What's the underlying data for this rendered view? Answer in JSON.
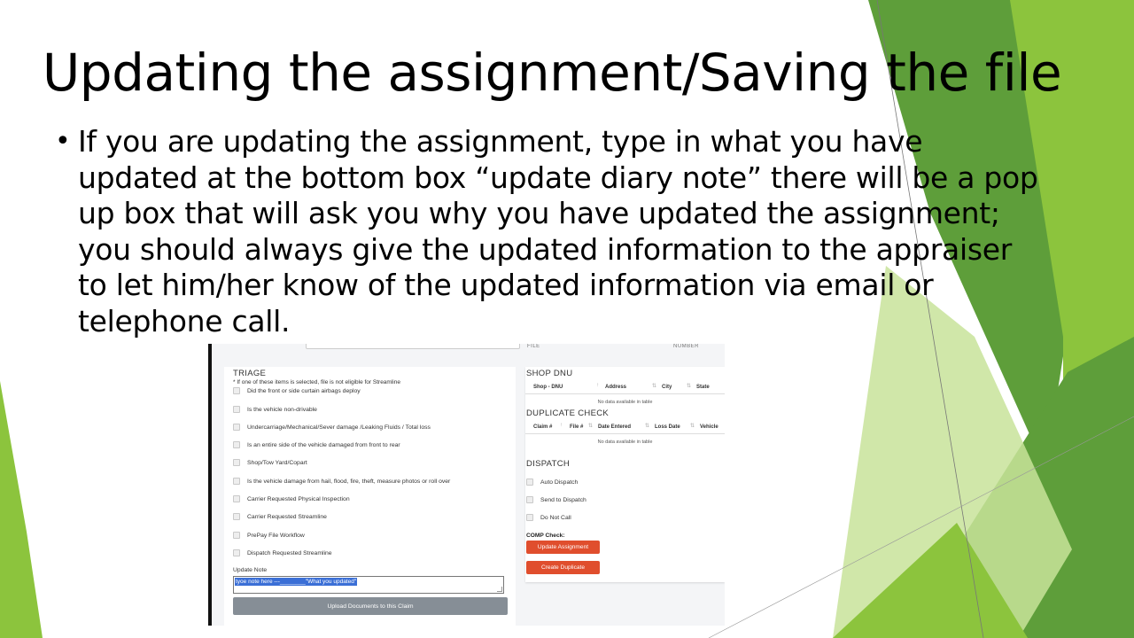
{
  "slide": {
    "title": "Updating the assignment/Saving the file",
    "bullet_symbol": "•",
    "bullet_text": "If you are updating the assignment, type in what you have updated at the bottom box “update diary note” there will be a pop up box that will ask you why you have updated the assignment; you should always give the updated information to the appraiser to let him/her know of the updated information via email or telephone call."
  },
  "colors": {
    "green_dark": "#3f7d2b",
    "green_mid": "#5e9e3a",
    "green_light": "#8cc43d",
    "green_pale": "#c8e39a",
    "button_red": "#e04e2d",
    "button_gray": "#868e96"
  },
  "screenshot": {
    "header_file": "FILE",
    "header_number": "NUMBER",
    "triage": {
      "title": "TRIAGE",
      "note": "* If one of these items is selected, file is not eligible for Streamline",
      "items": [
        "Did the front or side curtain airbags deploy",
        "Is the vehicle non-drivable",
        "Undercarriage/Mechanical/Sever damage /Leaking Fluids / Total loss",
        "Is an entire side of the vehicle damaged from front to rear",
        "Shop/Tow Yard/Copart",
        "Is the vehicle damage from hail, flood, fire, theft, measure photos or roll over",
        "Carrier Requested Physical Inspection",
        "Carrier Requested Streamline",
        "PrePay File Workflow",
        "Dispatch Requested Streamline"
      ]
    },
    "update_note": {
      "label": "Update Note",
      "value": "tyoe note here ---________\"What you updated\""
    },
    "upload_button": "Upload Documents to this Claim",
    "shop_dnu": {
      "title": "SHOP DNU",
      "columns": [
        "Shop - DNU",
        "Address",
        "City",
        "State"
      ],
      "empty": "No data available in table"
    },
    "duplicate_check": {
      "title": "DUPLICATE CHECK",
      "columns": [
        "Claim #",
        "File #",
        "Date Entered",
        "Loss Date",
        "Vehicle"
      ],
      "empty": "No data available in table"
    },
    "dispatch": {
      "title": "DISPATCH",
      "items": [
        "Auto Dispatch",
        "Send to Dispatch",
        "Do Not Call"
      ]
    },
    "comp_check_label": "COMP Check:",
    "update_assignment_button": "Update Assignment",
    "create_duplicate_button": "Create Duplicate"
  }
}
